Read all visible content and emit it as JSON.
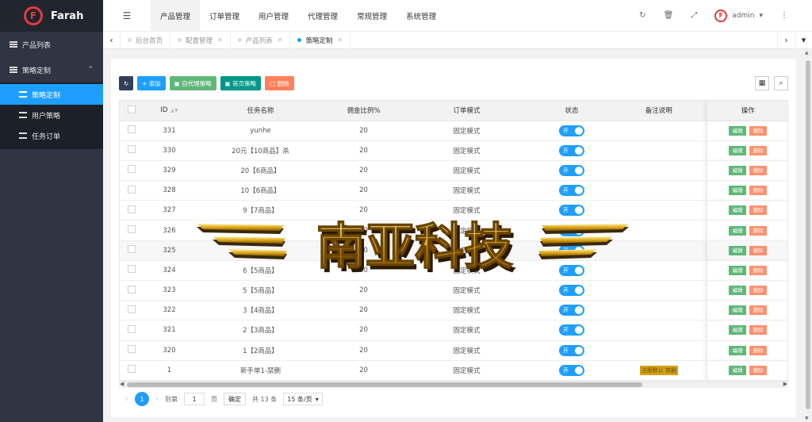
{
  "brand": {
    "logo_letter": "F",
    "name": "Farah"
  },
  "sidebar": {
    "items": [
      {
        "label": "产品列表"
      },
      {
        "label": "策略定制"
      }
    ],
    "group_arrow": "⌃",
    "submenu": [
      {
        "label": "策略定制"
      },
      {
        "label": "用户策略"
      },
      {
        "label": "任务订单"
      }
    ]
  },
  "header": {
    "toggle_icon": "☰",
    "nav": [
      {
        "label": "产品管理"
      },
      {
        "label": "订单管理"
      },
      {
        "label": "用户管理"
      },
      {
        "label": "代理管理"
      },
      {
        "label": "常规管理"
      },
      {
        "label": "系统管理"
      }
    ],
    "user": {
      "name": "admin",
      "avatar_letter": "F"
    }
  },
  "tabs": [
    {
      "label": "后台首页"
    },
    {
      "label": "配置管理"
    },
    {
      "label": "产品列表"
    },
    {
      "label": "策略定制"
    }
  ],
  "toolbar": {
    "add": "添加",
    "buy_strategy": "自代理策略",
    "first_strategy": "首页策略",
    "delete": "删除"
  },
  "table": {
    "headers": {
      "id": "ID",
      "name": "任务名称",
      "commission": "佣金比例%",
      "mode": "订单模式",
      "status": "状态",
      "note": "备注说明",
      "ops": "操作"
    },
    "switch_label": "开",
    "edit_label": "编辑",
    "del_label": "删除",
    "rows": [
      {
        "id": "331",
        "name": "yunhe",
        "commission": "20",
        "mode": "固定模式",
        "note": ""
      },
      {
        "id": "330",
        "name": "20元【10商品】杀",
        "commission": "20",
        "mode": "固定模式",
        "note": ""
      },
      {
        "id": "329",
        "name": "20【6商品】",
        "commission": "20",
        "mode": "固定模式",
        "note": ""
      },
      {
        "id": "328",
        "name": "10【6商品】",
        "commission": "20",
        "mode": "固定模式",
        "note": ""
      },
      {
        "id": "327",
        "name": "9【7商品】",
        "commission": "20",
        "mode": "固定模式",
        "note": ""
      },
      {
        "id": "326",
        "name": "",
        "commission": "20",
        "mode": "固定模式",
        "note": ""
      },
      {
        "id": "325",
        "name": "",
        "commission": "20",
        "mode": "固定模式",
        "note": ""
      },
      {
        "id": "324",
        "name": "6【5商品】",
        "commission": "20",
        "mode": "固定模式",
        "note": ""
      },
      {
        "id": "323",
        "name": "5【5商品】",
        "commission": "20",
        "mode": "固定模式",
        "note": ""
      },
      {
        "id": "322",
        "name": "3【4商品】",
        "commission": "20",
        "mode": "固定模式",
        "note": ""
      },
      {
        "id": "321",
        "name": "2【3商品】",
        "commission": "20",
        "mode": "固定模式",
        "note": ""
      },
      {
        "id": "320",
        "name": "1【2商品】",
        "commission": "20",
        "mode": "固定模式",
        "note": ""
      },
      {
        "id": "1",
        "name": "新手单1-禁删",
        "commission": "20",
        "mode": "固定模式",
        "note": "注册默认 禁删"
      }
    ]
  },
  "pager": {
    "current": "1",
    "goto_label": "到第",
    "page_input": "1",
    "page_unit": "页",
    "confirm": "确定",
    "total": "共 13 条",
    "per_page": "15 条/页"
  },
  "watermark": {
    "text": "南亚科技"
  }
}
